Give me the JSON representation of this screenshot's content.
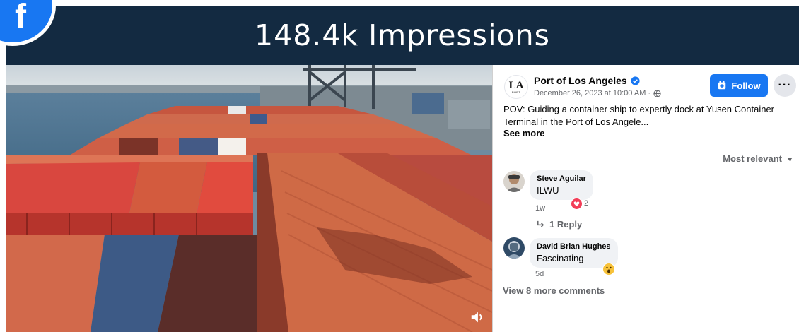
{
  "banner": {
    "title": "148.4k Impressions"
  },
  "brand": {
    "logo_letter": "f",
    "accent": "#1877f2",
    "banner_bg": "#132a41"
  },
  "post": {
    "page_logo_text": "LA",
    "page_logo_subtext": "PORT",
    "page_name": "Port of Los Angeles",
    "date": "December 26, 2023 at 10:00 AM ·",
    "follow_label": "Follow",
    "more_label": "···",
    "caption": "POV: Guiding a container ship to expertly dock at Yusen Container Terminal in the Port of Los Angele...",
    "see_more": "See more"
  },
  "comments": {
    "sort_label": "Most relevant",
    "items": [
      {
        "name": "Steve Aguilar",
        "text": "ILWU",
        "time": "1w",
        "reaction": "heart",
        "reaction_count": "2",
        "reply_label": "1 Reply"
      },
      {
        "name": "David Brian Hughes",
        "text": "Fascinating",
        "time": "5d",
        "reaction": "wow"
      }
    ],
    "view_more": "View 8 more comments"
  }
}
